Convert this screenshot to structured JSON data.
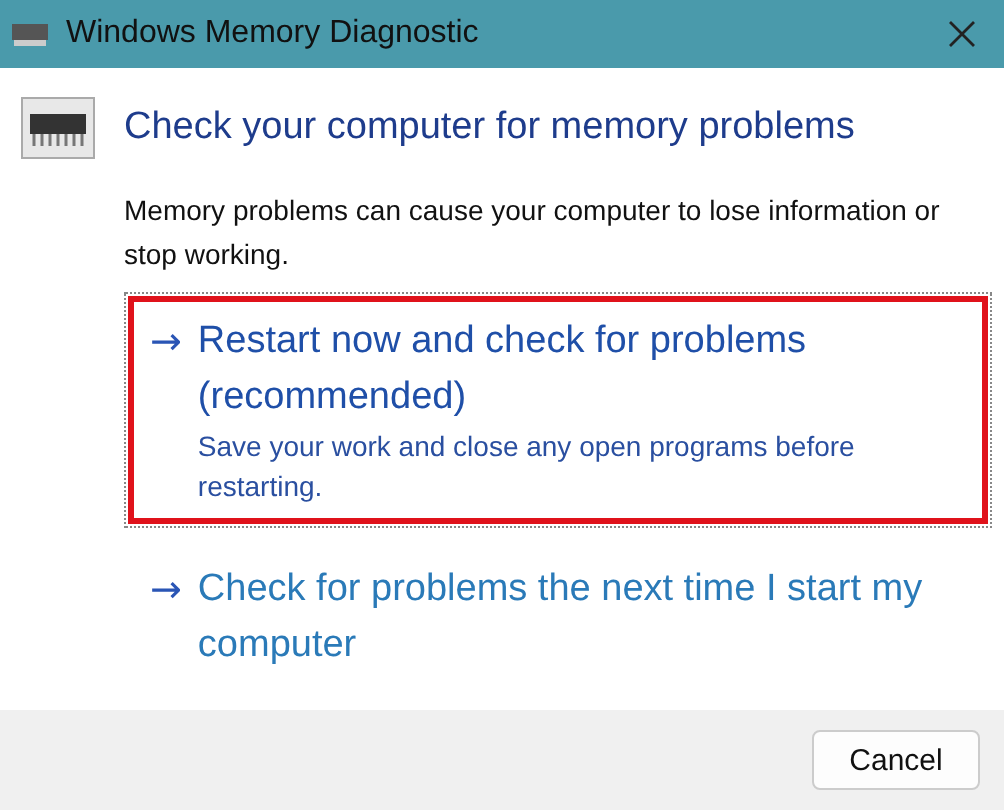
{
  "window": {
    "title": "Windows Memory Diagnostic"
  },
  "heading": "Check your computer for memory problems",
  "description": "Memory problems can cause your computer to lose information or stop working.",
  "options": [
    {
      "arrow": "→",
      "title": "Restart now and check for problems (recommended)",
      "subtitle": "Save your work and close any open programs before restarting.",
      "highlighted": true
    },
    {
      "arrow": "→",
      "title": "Check for problems the next time I start my computer",
      "highlighted": false
    }
  ],
  "buttons": [
    "Cancel"
  ]
}
